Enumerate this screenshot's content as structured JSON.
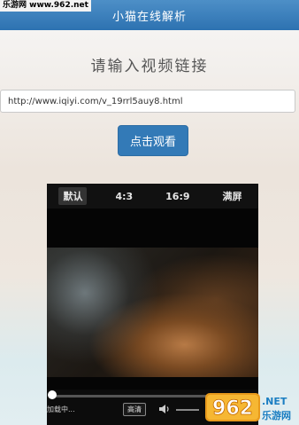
{
  "watermark_top": "乐游网 www.962.net",
  "header": {
    "title": "小猫在线解析"
  },
  "prompt": "请输入视频链接",
  "url_input": {
    "value": "http://www.iqiyi.com/v_19rrl5auy8.html"
  },
  "watch_button": {
    "label": "点击观看"
  },
  "player": {
    "ratio_options": [
      {
        "label": "默认",
        "active": true
      },
      {
        "label": "4:3",
        "active": false
      },
      {
        "label": "16:9",
        "active": false
      },
      {
        "label": "满屏",
        "active": false
      }
    ],
    "progress": 0.0,
    "status_text": "加载中...",
    "quality_label": "高清",
    "volume_icon": "speaker-icon"
  },
  "watermark_logo": {
    "number": "962",
    "suffix": ".NET",
    "sub": "乐游网"
  },
  "colors": {
    "header": "#2d72b1",
    "button": "#337ab7"
  }
}
